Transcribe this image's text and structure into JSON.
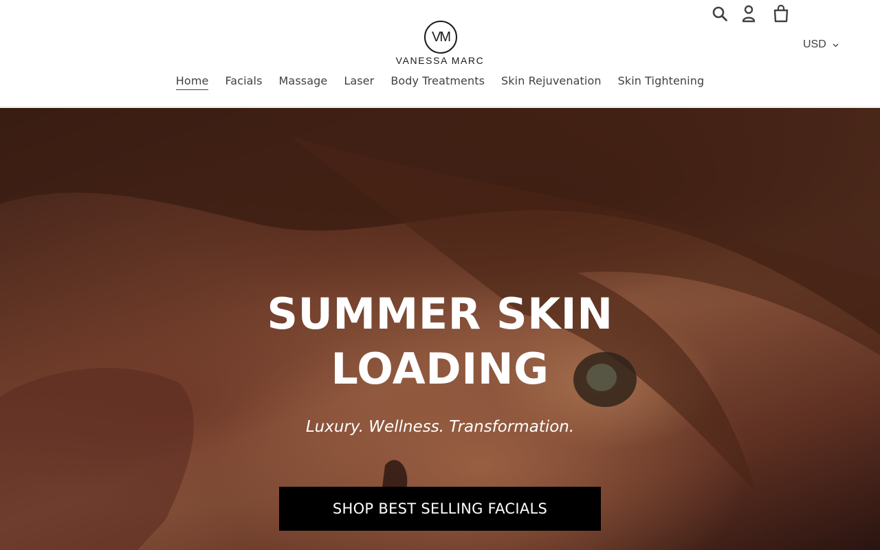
{
  "brand": {
    "monogram": "VM",
    "name": "VANESSA MARC"
  },
  "header": {
    "icons": [
      "search-icon",
      "account-icon",
      "cart-icon"
    ],
    "currency": "USD"
  },
  "nav": {
    "items": [
      {
        "label": "Home",
        "active": true
      },
      {
        "label": "Facials"
      },
      {
        "label": "Massage"
      },
      {
        "label": "Laser"
      },
      {
        "label": "Body Treatments"
      },
      {
        "label": "Skin Rejuvenation"
      },
      {
        "label": "Skin Tightening"
      }
    ]
  },
  "hero": {
    "title_line1": "SUMMER SKIN",
    "title_line2": "LOADING",
    "subtitle": "Luxury. Wellness. Transformation.",
    "cta_label": "SHOP BEST SELLING FACIALS"
  },
  "colors": {
    "nav_text": "#3d4246",
    "cta_bg": "#000000",
    "hero_text": "#ffffff"
  }
}
